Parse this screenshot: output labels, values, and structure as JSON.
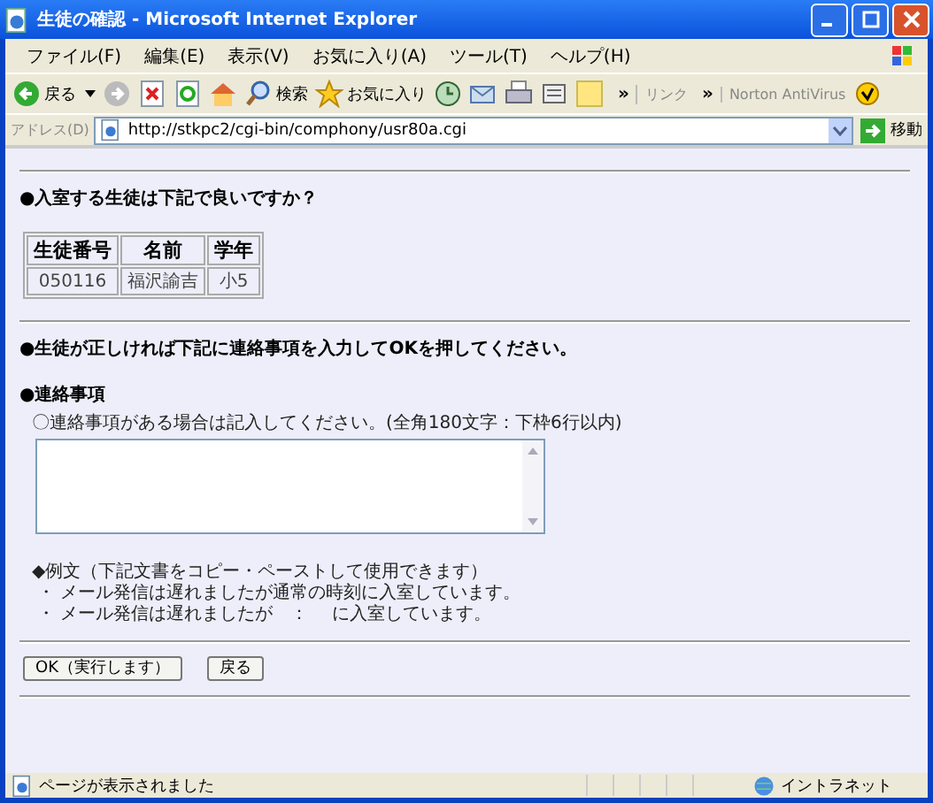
{
  "window": {
    "title": "生徒の確認 - Microsoft Internet Explorer"
  },
  "menu": [
    "ファイル(F)",
    "編集(E)",
    "表示(V)",
    "お気に入り(A)",
    "ツール(T)",
    "ヘルプ(H)"
  ],
  "toolbar": {
    "back": "戻る",
    "search": "検索",
    "favorites": "お気に入り",
    "chevron": "»",
    "links": "リンク",
    "links_chevron": "»",
    "norton": "Norton AntiVirus"
  },
  "address": {
    "label": "アドレス(D)",
    "url": "http://stkpc2/cgi-bin/comphony/usr80a.cgi",
    "go": "移動"
  },
  "page": {
    "question": "●入室する生徒は下記で良いですか？",
    "table": {
      "columns": [
        "生徒番号",
        "名前",
        "学年"
      ],
      "rows": [
        [
          "050116",
          "福沢諭吉",
          "小5"
        ]
      ]
    },
    "instruction": "●生徒が正しければ下記に連絡事項を入力してOKを押してください。",
    "section_title": "●連絡事項",
    "hint": "〇連絡事項がある場合は記入してください。(全角180文字：下枠6行以内)",
    "example_heading": "◆例文（下記文書をコピー・ペーストして使用できます）",
    "examples": [
      "・ メール発信は遅れましたが通常の時刻に入室しています。",
      "・ メール発信は遅れましたが　：　 に入室しています。"
    ],
    "buttons": [
      "OK（実行します）",
      "戻る"
    ]
  },
  "status_bar": {
    "message": "ページが表示されました",
    "zone": "イントラネット"
  }
}
